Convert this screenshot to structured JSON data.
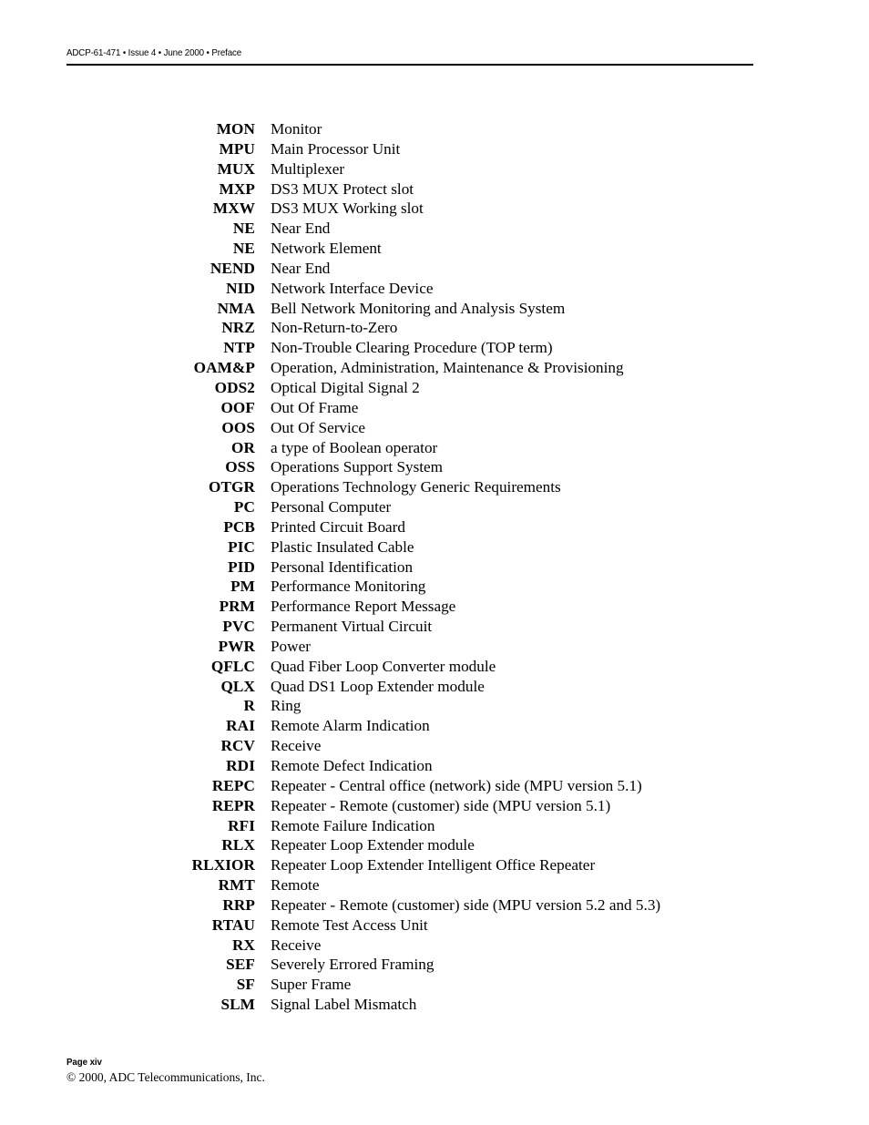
{
  "header": {
    "text": "ADCP-61-471 • Issue 4 • June 2000 • Preface"
  },
  "footer": {
    "page_label": "Page xiv",
    "copyright": "© 2000, ADC Telecommunications, Inc."
  },
  "glossary": {
    "entries": [
      {
        "term": "MON",
        "definition": "Monitor"
      },
      {
        "term": "MPU",
        "definition": "Main Processor Unit"
      },
      {
        "term": "MUX",
        "definition": "Multiplexer"
      },
      {
        "term": "MXP",
        "definition": "DS3 MUX Protect slot"
      },
      {
        "term": "MXW",
        "definition": "DS3 MUX Working slot"
      },
      {
        "term": "NE",
        "definition": "Near End"
      },
      {
        "term": "NE",
        "definition": "Network Element"
      },
      {
        "term": "NEND",
        "definition": "Near End"
      },
      {
        "term": "NID",
        "definition": "Network Interface Device"
      },
      {
        "term": "NMA",
        "definition": "Bell Network Monitoring and Analysis System"
      },
      {
        "term": "NRZ",
        "definition": "Non-Return-to-Zero"
      },
      {
        "term": "NTP",
        "definition": "Non-Trouble Clearing Procedure (TOP term)"
      },
      {
        "term": "OAM&P",
        "definition": "Operation, Administration, Maintenance & Provisioning"
      },
      {
        "term": "ODS2",
        "definition": "Optical Digital Signal 2"
      },
      {
        "term": "OOF",
        "definition": "Out Of Frame"
      },
      {
        "term": "OOS",
        "definition": "Out Of Service"
      },
      {
        "term": "OR",
        "definition": "a type of Boolean operator"
      },
      {
        "term": "OSS",
        "definition": "Operations Support System"
      },
      {
        "term": "OTGR",
        "definition": "Operations Technology Generic Requirements"
      },
      {
        "term": "PC",
        "definition": "Personal Computer"
      },
      {
        "term": "PCB",
        "definition": "Printed Circuit Board"
      },
      {
        "term": "PIC",
        "definition": "Plastic Insulated Cable"
      },
      {
        "term": "PID",
        "definition": "Personal Identification"
      },
      {
        "term": "PM",
        "definition": "Performance Monitoring"
      },
      {
        "term": "PRM",
        "definition": "Performance Report Message"
      },
      {
        "term": "PVC",
        "definition": "Permanent Virtual Circuit"
      },
      {
        "term": "PWR",
        "definition": "Power"
      },
      {
        "term": "QFLC",
        "definition": "Quad Fiber Loop Converter module"
      },
      {
        "term": "QLX",
        "definition": "Quad DS1 Loop Extender module"
      },
      {
        "term": "R",
        "definition": "Ring"
      },
      {
        "term": "RAI",
        "definition": "Remote Alarm Indication"
      },
      {
        "term": "RCV",
        "definition": "Receive"
      },
      {
        "term": "RDI",
        "definition": "Remote Defect Indication"
      },
      {
        "term": "REPC",
        "definition": "Repeater - Central office (network) side (MPU version 5.1)"
      },
      {
        "term": "REPR",
        "definition": "Repeater - Remote (customer) side (MPU version 5.1)"
      },
      {
        "term": "RFI",
        "definition": "Remote Failure Indication"
      },
      {
        "term": "RLX",
        "definition": "Repeater Loop Extender module"
      },
      {
        "term": "RLXIOR",
        "definition": "Repeater Loop Extender Intelligent Office Repeater"
      },
      {
        "term": "RMT",
        "definition": "Remote"
      },
      {
        "term": "RRP",
        "definition": "Repeater - Remote (customer) side (MPU version 5.2 and 5.3)"
      },
      {
        "term": "RTAU",
        "definition": "Remote Test Access Unit"
      },
      {
        "term": "RX",
        "definition": "Receive"
      },
      {
        "term": "SEF",
        "definition": "Severely Errored Framing"
      },
      {
        "term": "SF",
        "definition": "Super Frame"
      },
      {
        "term": "SLM",
        "definition": "Signal Label Mismatch"
      }
    ]
  }
}
